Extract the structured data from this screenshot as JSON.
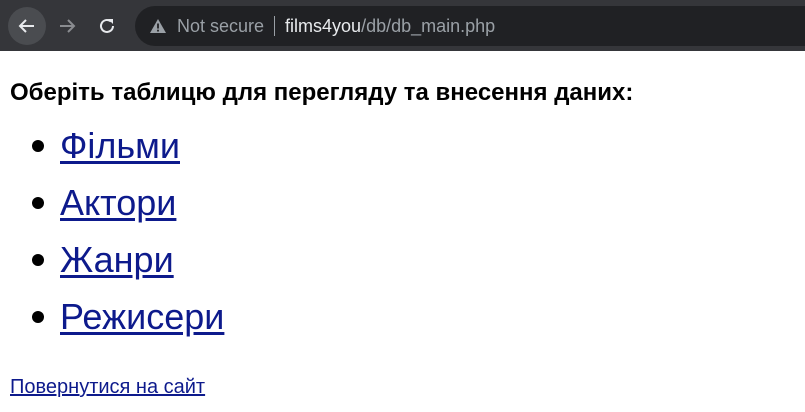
{
  "browser": {
    "security_label": "Not secure",
    "url_host": "films4you",
    "url_path": "/db/db_main.php",
    "icons": {
      "back": "back-arrow-icon",
      "forward": "forward-arrow-icon",
      "reload": "reload-icon",
      "warning": "warning-icon"
    }
  },
  "page": {
    "title": "Оберіть таблицю для перегляду та внесення даних:",
    "links": [
      {
        "label": "Фільми"
      },
      {
        "label": "Актори"
      },
      {
        "label": "Жанри"
      },
      {
        "label": "Режисери"
      }
    ],
    "back_link": "Повернутися на сайт"
  },
  "colors": {
    "toolbar": "#35363a",
    "omnibox": "#202124",
    "link": "#0d1a8c"
  }
}
